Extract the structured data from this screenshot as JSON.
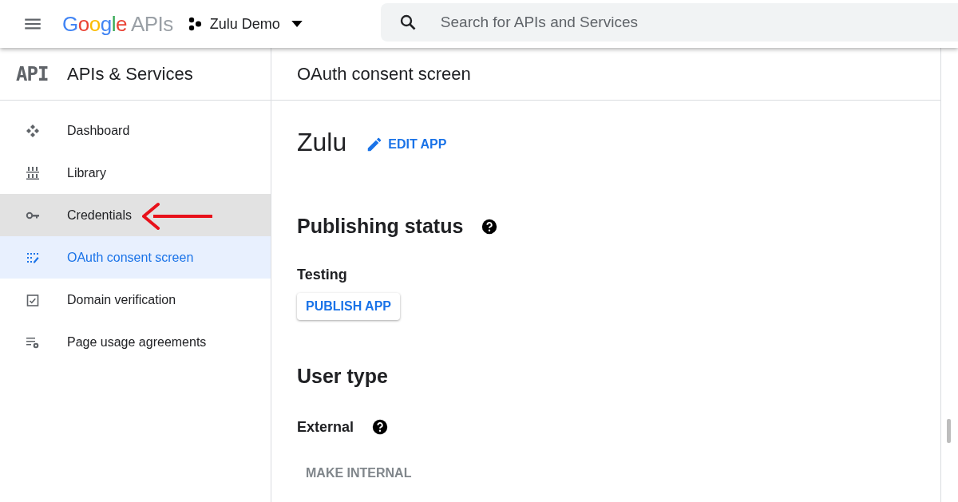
{
  "header": {
    "logo": {
      "brand": "Google",
      "product": "APIs"
    },
    "project": "Zulu Demo",
    "search": {
      "placeholder": "Search for APIs and Services"
    }
  },
  "sidebar": {
    "badge": "API",
    "title": "APIs & Services",
    "items": [
      {
        "kind": "dashboard",
        "label": "Dashboard",
        "selected": false,
        "hovered": false,
        "annotated": false
      },
      {
        "kind": "library",
        "label": "Library",
        "selected": false,
        "hovered": false,
        "annotated": false
      },
      {
        "kind": "credentials",
        "label": "Credentials",
        "selected": false,
        "hovered": true,
        "annotated": true
      },
      {
        "kind": "oauth",
        "label": "OAuth consent screen",
        "selected": true,
        "hovered": false,
        "annotated": false
      },
      {
        "kind": "domain",
        "label": "Domain verification",
        "selected": false,
        "hovered": false,
        "annotated": false
      },
      {
        "kind": "agreements",
        "label": "Page usage agreements",
        "selected": false,
        "hovered": false,
        "annotated": false
      }
    ]
  },
  "main": {
    "page_title": "OAuth consent screen",
    "app_name": "Zulu",
    "edit_button": "EDIT APP",
    "publishing": {
      "heading": "Publishing status",
      "status": "Testing",
      "button": {
        "label": "PUBLISH APP",
        "disabled": false
      }
    },
    "user_type": {
      "heading": "User type",
      "value": "External",
      "button": {
        "label": "MAKE INTERNAL",
        "disabled": true
      }
    }
  }
}
